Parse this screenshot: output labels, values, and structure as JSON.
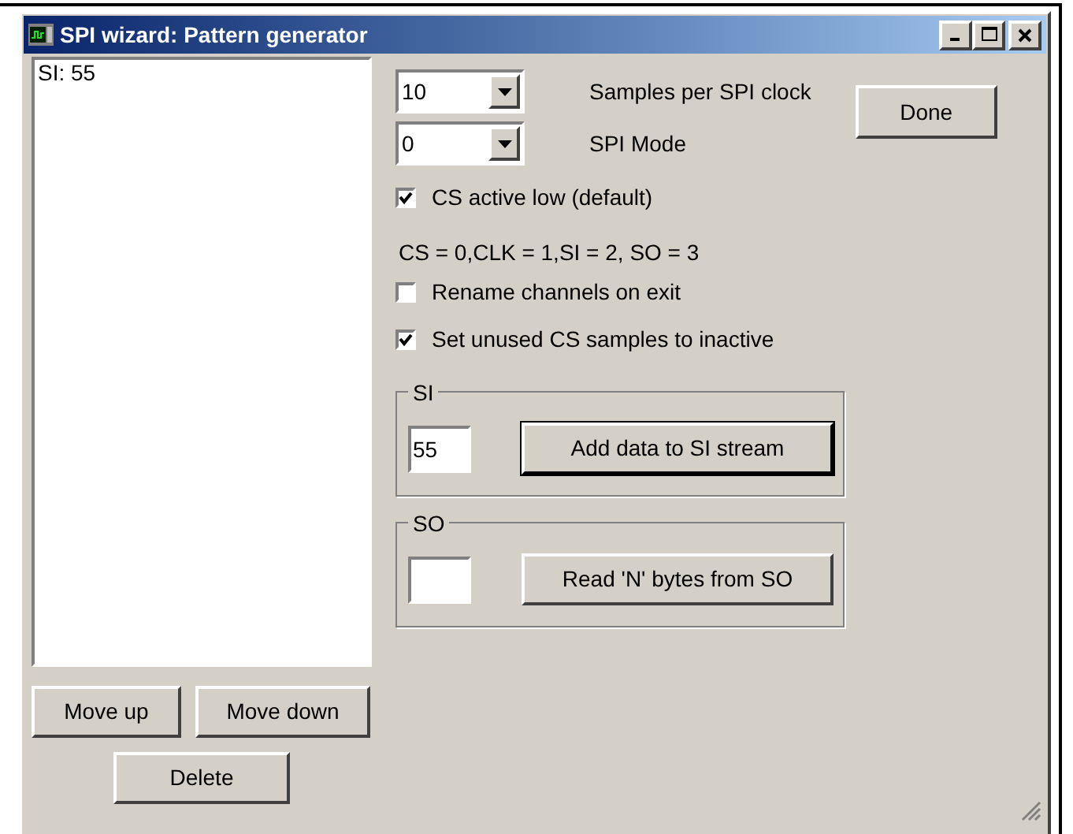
{
  "window": {
    "title": "SPI wizard: Pattern generator"
  },
  "list": {
    "items": [
      {
        "text": "SI: 55",
        "selected": false
      }
    ]
  },
  "list_buttons": [
    "Move up",
    "Move down",
    "Delete"
  ],
  "samples_per_clock": {
    "value": "10",
    "label": "Samples per SPI clock"
  },
  "spi_mode": {
    "value": "0",
    "label": "SPI Mode"
  },
  "done_button": "Done",
  "cs_active_low": {
    "label": "CS active low (default)",
    "checked": true
  },
  "channel_map": "CS = 0,CLK = 1,SI = 2, SO = 3",
  "options": [
    {
      "label": "Rename channels on exit",
      "checked": false
    },
    {
      "label": "Set unused CS samples to inactive",
      "checked": true
    }
  ],
  "groups": [
    {
      "title": "SI",
      "value": "55",
      "button": "Add data to SI stream",
      "default": true
    },
    {
      "title": "SO",
      "button": "Read 'N' bytes from SO",
      "default": false
    }
  ]
}
